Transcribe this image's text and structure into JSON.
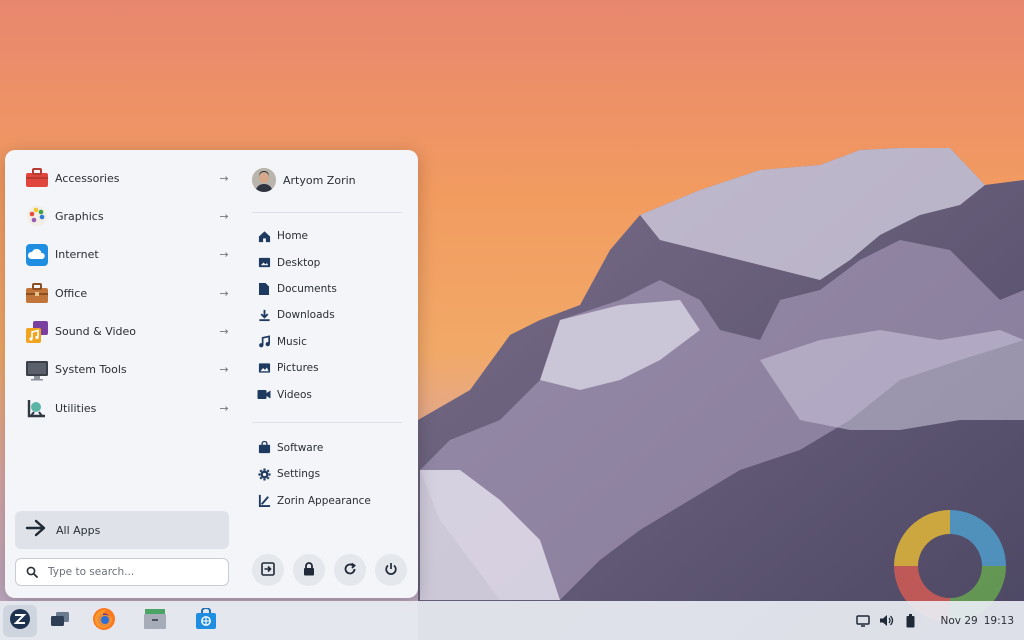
{
  "menu": {
    "categories": [
      {
        "label": "Accessories",
        "icon": "toolbox-icon"
      },
      {
        "label": "Graphics",
        "icon": "palette-icon"
      },
      {
        "label": "Internet",
        "icon": "cloud-icon"
      },
      {
        "label": "Office",
        "icon": "briefcase-icon"
      },
      {
        "label": "Sound & Video",
        "icon": "music-video-icon"
      },
      {
        "label": "System Tools",
        "icon": "monitor-icon"
      },
      {
        "label": "Utilities",
        "icon": "utilities-icon"
      }
    ],
    "all_apps_label": "All Apps",
    "search_placeholder": "Type to search...",
    "user_name": "Artyom Zorin",
    "places": [
      {
        "label": "Home",
        "icon": "home-icon"
      },
      {
        "label": "Desktop",
        "icon": "desktop-icon"
      },
      {
        "label": "Documents",
        "icon": "document-icon"
      },
      {
        "label": "Downloads",
        "icon": "download-icon"
      },
      {
        "label": "Music",
        "icon": "music-icon"
      },
      {
        "label": "Pictures",
        "icon": "picture-icon"
      },
      {
        "label": "Videos",
        "icon": "video-icon"
      }
    ],
    "system": [
      {
        "label": "Software",
        "icon": "software-bag-icon"
      },
      {
        "label": "Settings",
        "icon": "gear-icon"
      },
      {
        "label": "Zorin Appearance",
        "icon": "appearance-icon"
      }
    ],
    "power_buttons": [
      "logout-icon",
      "lock-icon",
      "restart-icon",
      "power-icon"
    ]
  },
  "taskbar": {
    "date": "Nov 29",
    "time": "19:13",
    "apps": [
      "zorin-menu-icon",
      "window-switcher-icon",
      "firefox-icon",
      "files-icon",
      "software-store-icon"
    ],
    "tray": [
      "screen-icon",
      "volume-icon",
      "battery-icon"
    ]
  },
  "colors": {
    "accent_dark": "#1f3a5f",
    "menu_bg": "#f3f5f8",
    "taskbar_bg": "#e8ecf2"
  }
}
